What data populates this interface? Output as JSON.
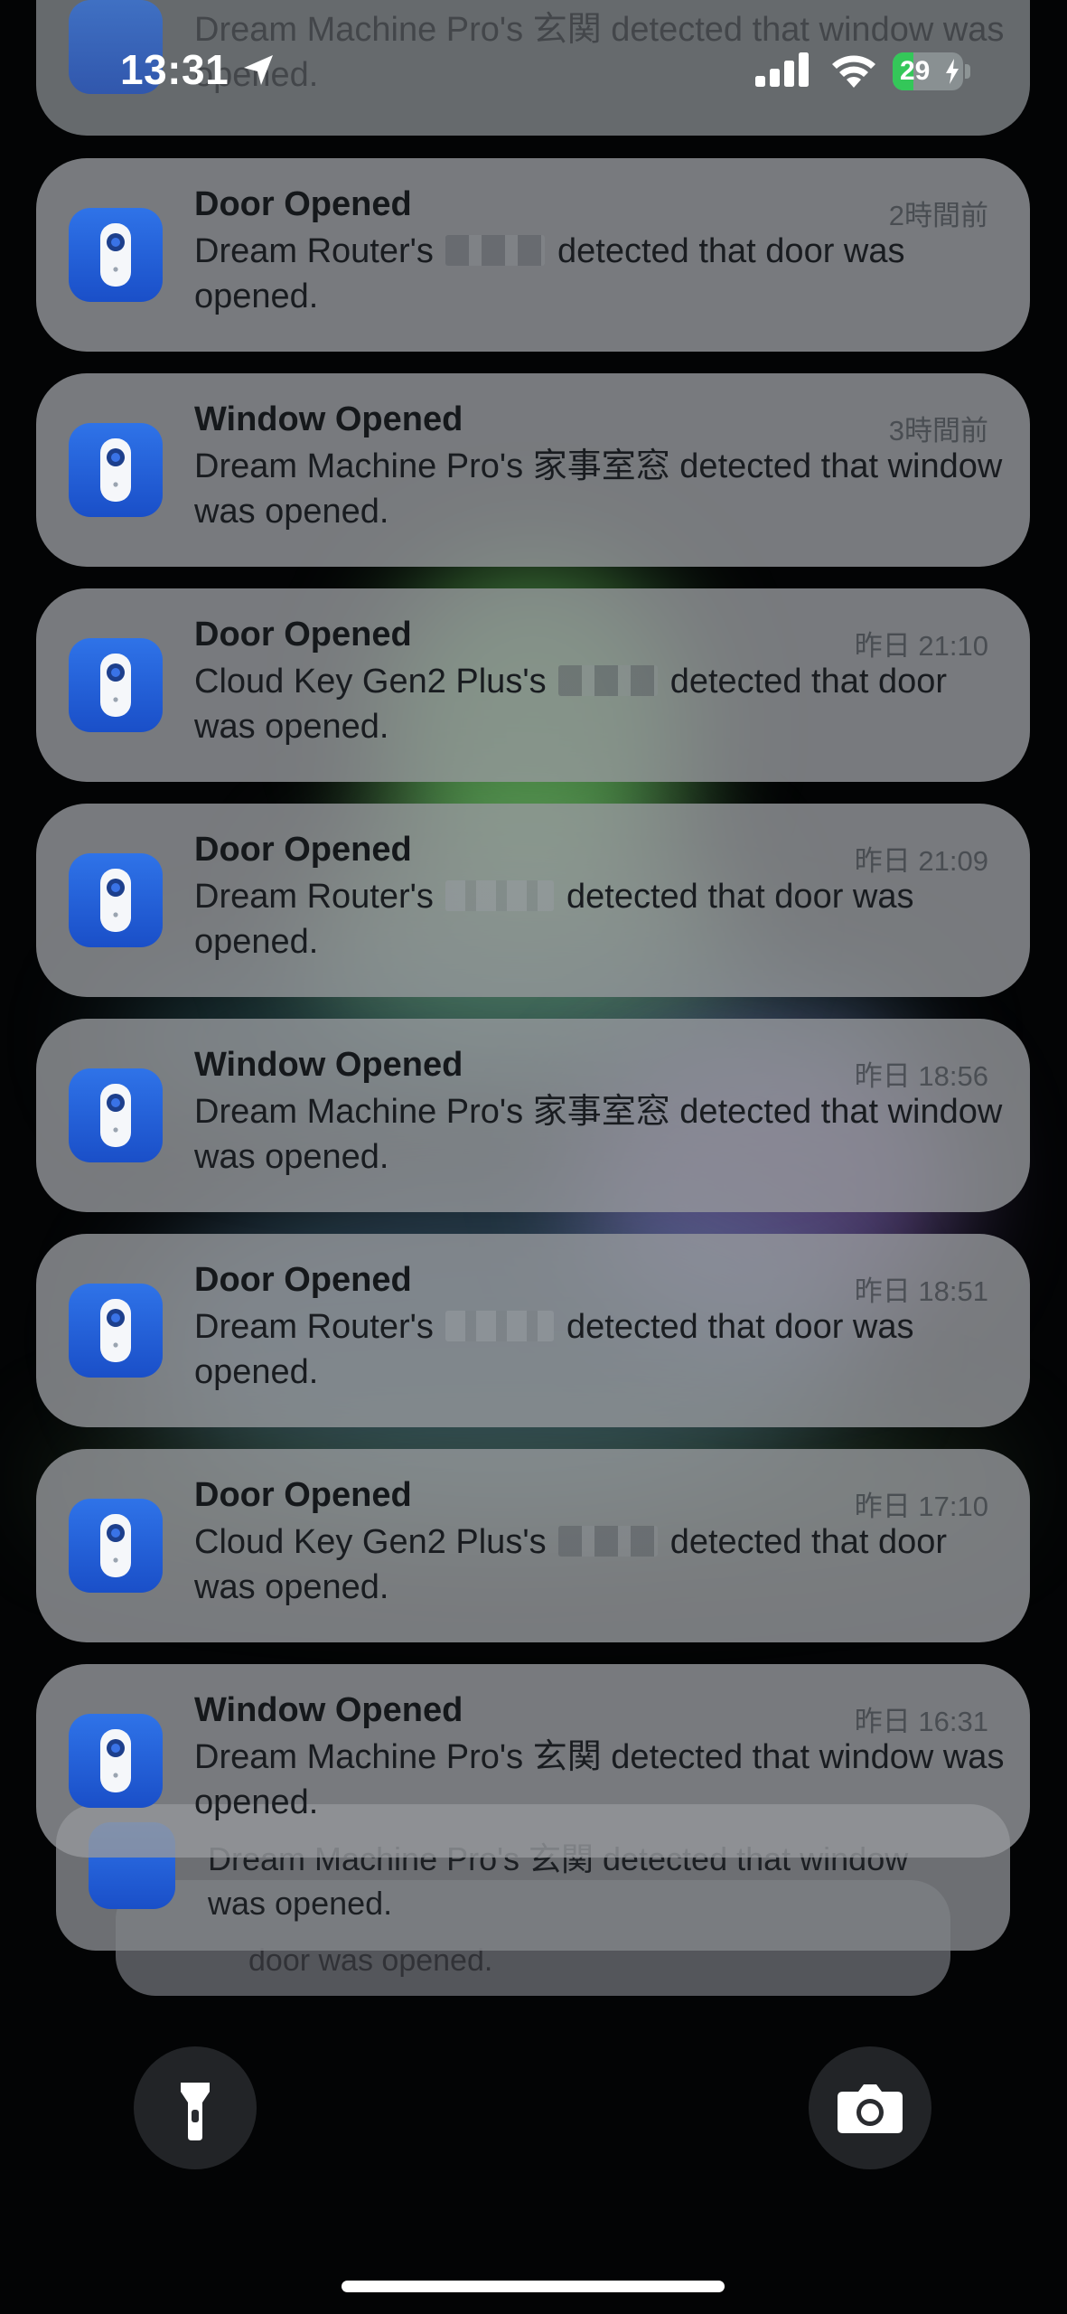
{
  "status_bar": {
    "time": "13:31",
    "battery_level": "29",
    "battery_fraction": 0.29,
    "battery_charging": true,
    "location_icon": "location-arrow-icon",
    "cellular_icon": "cellular-signal-icon",
    "wifi_icon": "wifi-icon"
  },
  "app_icon": "door-sensor-icon",
  "partial_top_notification": {
    "body": "Dream Machine Pro's 玄関 detected that window was opened."
  },
  "notifications": [
    {
      "title": "Door Opened",
      "time": "2時間前",
      "body_prefix": "Dream Router's",
      "sensor_name": "■■■",
      "body_suffix": "detected that door was opened."
    },
    {
      "title": "Window Opened",
      "time": "3時間前",
      "body_prefix": "Dream Machine Pro's",
      "sensor_name": "家事室窓",
      "body_suffix": "detected that window was opened."
    },
    {
      "title": "Door Opened",
      "time": "昨日 21:10",
      "body_prefix": "Cloud Key Gen2 Plus's",
      "sensor_name": "■■■",
      "body_suffix": "detected that door was opened."
    },
    {
      "title": "Door Opened",
      "time": "昨日 21:09",
      "body_prefix": "Dream Router's",
      "sensor_name": "■■■",
      "body_suffix": "detected that door was opened."
    },
    {
      "title": "Window Opened",
      "time": "昨日 18:56",
      "body_prefix": "Dream Machine Pro's",
      "sensor_name": "家事室窓",
      "body_suffix": "detected that window was opened."
    },
    {
      "title": "Door Opened",
      "time": "昨日 18:51",
      "body_prefix": "Dream Router's",
      "sensor_name": "■■■",
      "body_suffix": "detected that door was opened."
    },
    {
      "title": "Door Opened",
      "time": "昨日 17:10",
      "body_prefix": "Cloud Key Gen2 Plus's",
      "sensor_name": "■■■",
      "body_suffix": "detected that door was opened."
    },
    {
      "title": "Window Opened",
      "time": "昨日 16:31",
      "body_prefix": "Dream Machine Pro's",
      "sensor_name": "玄関",
      "body_suffix": "detected that window was opened."
    }
  ],
  "stacked_behind": {
    "first_body": "Dream Machine Pro's 玄関 detected that window was opened.",
    "second_body": "door was opened."
  },
  "lockscreen_controls": {
    "flashlight_icon": "flashlight-icon",
    "camera_icon": "camera-icon"
  },
  "colors": {
    "app_icon_blue": "#1f5ed6",
    "battery_green": "#34c759",
    "card_gray": "#96999c"
  }
}
